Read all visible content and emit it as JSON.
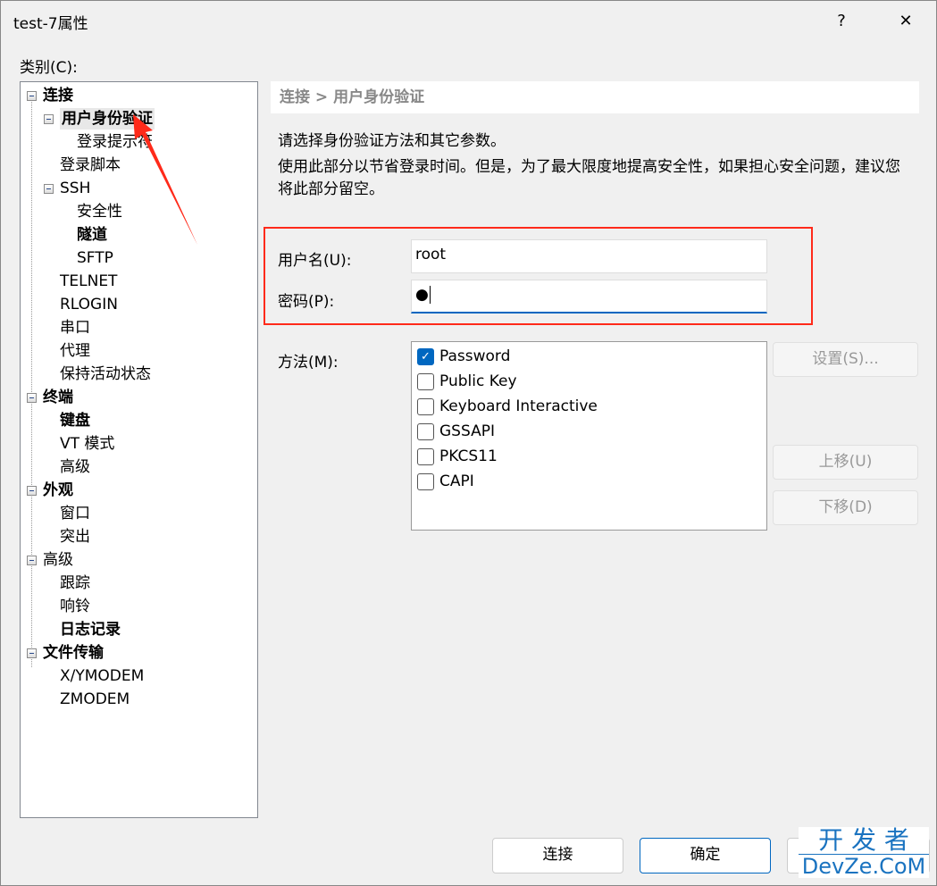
{
  "window": {
    "title": "test-7属性",
    "help": "?",
    "close": "✕"
  },
  "category_label": "类别(C):",
  "tree": [
    {
      "label": "连接",
      "level": 0,
      "bold": true,
      "box": true
    },
    {
      "label": "用户身份验证",
      "level": 1,
      "bold": true,
      "box": true,
      "selected": true
    },
    {
      "label": "登录提示符",
      "level": 2
    },
    {
      "label": "登录脚本",
      "level": 1
    },
    {
      "label": "SSH",
      "level": 1,
      "box": true
    },
    {
      "label": "安全性",
      "level": 2
    },
    {
      "label": "隧道",
      "level": 2,
      "bold": true
    },
    {
      "label": "SFTP",
      "level": 2
    },
    {
      "label": "TELNET",
      "level": 1
    },
    {
      "label": "RLOGIN",
      "level": 1
    },
    {
      "label": "串口",
      "level": 1
    },
    {
      "label": "代理",
      "level": 1
    },
    {
      "label": "保持活动状态",
      "level": 1
    },
    {
      "label": "终端",
      "level": 0,
      "bold": true,
      "box": true
    },
    {
      "label": "键盘",
      "level": 1,
      "bold": true
    },
    {
      "label": "VT 模式",
      "level": 1
    },
    {
      "label": "高级",
      "level": 1
    },
    {
      "label": "外观",
      "level": 0,
      "bold": true,
      "box": true
    },
    {
      "label": "窗口",
      "level": 1
    },
    {
      "label": "突出",
      "level": 1
    },
    {
      "label": "高级",
      "level": 0,
      "box": true
    },
    {
      "label": "跟踪",
      "level": 1
    },
    {
      "label": "响铃",
      "level": 1
    },
    {
      "label": "日志记录",
      "level": 1,
      "bold": true
    },
    {
      "label": "文件传输",
      "level": 0,
      "bold": true,
      "box": true
    },
    {
      "label": "X/YMODEM",
      "level": 1
    },
    {
      "label": "ZMODEM",
      "level": 1
    }
  ],
  "panel": {
    "breadcrumb": "连接 > 用户身份验证",
    "desc1": "请选择身份验证方法和其它参数。",
    "desc2": "使用此部分以节省登录时间。但是，为了最大限度地提高安全性，如果担心安全问题，建议您将此部分留空。",
    "username_label": "用户名(U):",
    "username": "root",
    "password_label": "密码(P):",
    "password": "●",
    "method_label": "方法(M):",
    "methods": [
      {
        "label": "Password",
        "checked": true
      },
      {
        "label": "Public Key"
      },
      {
        "label": "Keyboard Interactive"
      },
      {
        "label": "GSSAPI"
      },
      {
        "label": "PKCS11"
      },
      {
        "label": "CAPI"
      }
    ],
    "settings": "设置(S)...",
    "up": "上移(U)",
    "down": "下移(D)"
  },
  "footer": {
    "connect": "连接",
    "ok": "确定"
  },
  "watermark": {
    "line1": "开 发 者",
    "line2": "DevZe.CoM"
  },
  "colors": {
    "highlight": "#ff2a1a",
    "accent": "#0067c0"
  }
}
